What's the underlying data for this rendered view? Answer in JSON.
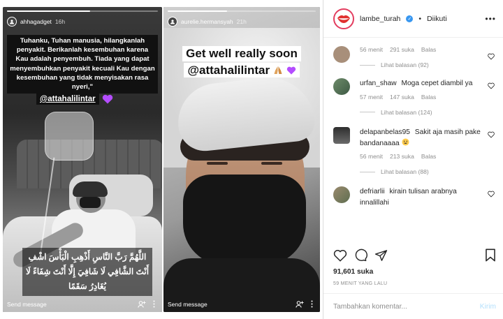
{
  "story_left": {
    "username": "ahhagadget",
    "time": "16h",
    "caption": "Tuhanku, Tuhan manusia, hilangkanlah penyakit. Berikanlah kesembuhan karena Kau adalah penyembuh. Tiada yang dapat menyembuhkan penyakit kecuali Kau dengan kesembuhan yang tidak menyisakan rasa nyeri,\"",
    "mention": "@attahalilintar",
    "arabic": "اللَّهُمَّ رَبَّ النَّاسِ أَذْهِبِ الْبَأْسَ اشْفِ أَنْتَ الشَّافِي لَا شَافِيَ إِلَّا أَنْتَ شِفَاءً لَا يُغَادِرُ سَقَمًا",
    "send_message": "Send message",
    "progress": 0.55
  },
  "story_right": {
    "username": "aurelie.hermansyah",
    "time": "21h",
    "caption_line1": "Get well really soon",
    "caption_line2": "@attahalilintar",
    "send_message": "Send message",
    "progress": 0.4
  },
  "post": {
    "username": "lambe_turah",
    "follow_status": "Diikuti",
    "separator": "•",
    "more": "•••",
    "comments": [
      {
        "username": "",
        "text": "",
        "time": "56 menit",
        "likes": "291 suka",
        "reply": "Balas",
        "view_replies": "Lihat balasan (92)"
      },
      {
        "username": "urfan_shaw",
        "text": "Moga cepet diambil ya",
        "time": "57 menit",
        "likes": "147 suka",
        "reply": "Balas",
        "view_replies": "Lihat balasan (124)"
      },
      {
        "username": "delapanbelas95",
        "text": "Sakit aja masih pake bandanaaaa",
        "time": "56 menit",
        "likes": "213 suka",
        "reply": "Balas",
        "view_replies": "Lihat balasan (88)"
      },
      {
        "username": "defriarlii",
        "text": "kirain tulisan arabnya innalillahi",
        "time": "",
        "likes": "",
        "reply": "",
        "view_replies": ""
      }
    ],
    "like_count": "91,601",
    "like_word": "suka",
    "time_ago": "59 MENIT YANG LALU",
    "comment_placeholder": "Tambahkan komentar...",
    "post_button": "Kirim"
  },
  "colors": {
    "brand_ring": "#e33d5f",
    "verified": "#3897f0",
    "heart": "#b44dff",
    "post_button_disabled": "#b2dffc"
  },
  "icons": [
    "heart-icon",
    "comment-icon",
    "share-icon",
    "bookmark-icon",
    "more-icon",
    "verified-icon",
    "smile-emoji-icon",
    "praying-hands-icon",
    "purple-heart-icon",
    "mention-icon",
    "camera-icon"
  ]
}
